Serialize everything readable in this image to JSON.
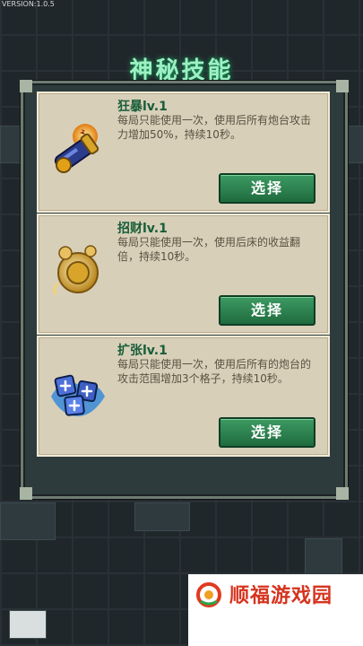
{
  "version": "VERSION:1.0.5",
  "title": "神秘技能",
  "skills": [
    {
      "name": "狂暴lv.1",
      "desc": "每局只能使用一次，使用后所有炮台攻击力增加50%，持续10秒。",
      "button": "选择",
      "icon": "cannon-icon"
    },
    {
      "name": "招财lv.1",
      "desc": "每局只能使用一次，使用后床的收益翻倍，持续10秒。",
      "button": "选择",
      "icon": "coin-icon"
    },
    {
      "name": "扩张lv.1",
      "desc": "每局只能使用一次，使用后所有的炮台的攻击范围增加3个格子，持续10秒。",
      "button": "选择",
      "icon": "dice-icon"
    }
  ],
  "watermark": {
    "text": "顺福游戏园"
  },
  "colors": {
    "title": "#9ef0c4",
    "card": "#d8cfb9",
    "button": "#2c8a52",
    "skill_name": "#175d38"
  }
}
